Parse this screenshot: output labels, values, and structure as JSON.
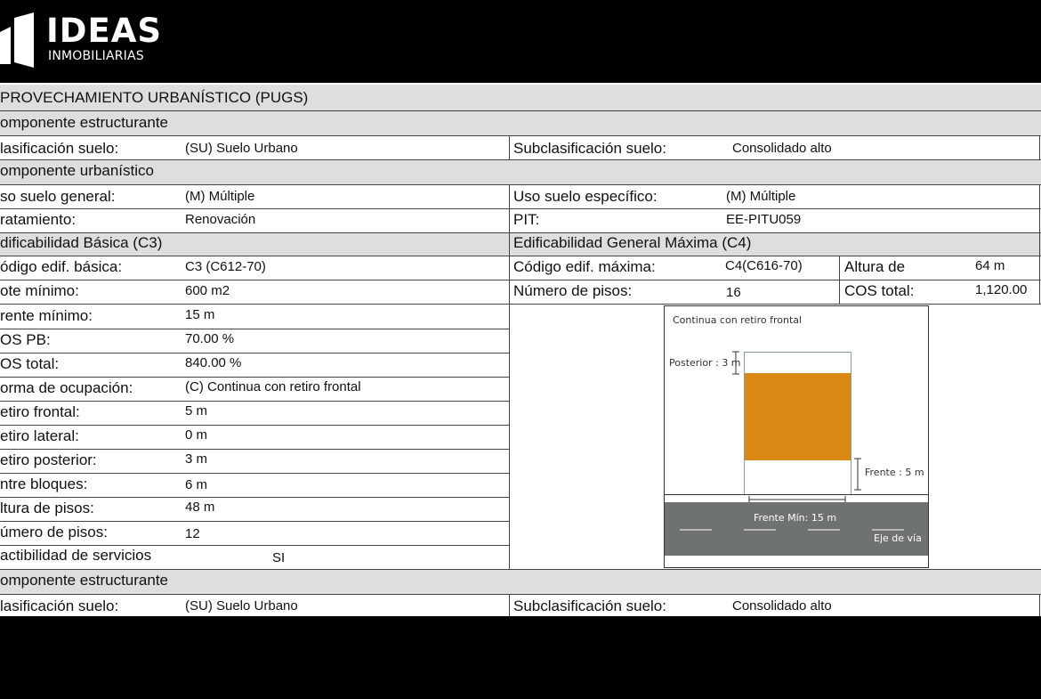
{
  "logo": {
    "title": "IDEAS",
    "subtitle": "INMOBILIARIAS"
  },
  "section_title": "PROVECHAMIENTO URBANÍSTICO (PUGS)",
  "comp1": {
    "header": "omponente  estructurante",
    "clas_label": "lasificación suelo:",
    "clas_value": "(SU) Suelo Urbano",
    "subclas_label": "Subclasificación suelo:",
    "subclas_value": "Consolidado alto"
  },
  "comp2": {
    "header": "omponente  urbanístico",
    "uso_gen_label": "so suelo general:",
    "uso_gen_value": "(M) Múltiple",
    "uso_esp_label": "Uso suelo específico:",
    "uso_esp_value": "(M) Múltiple",
    "trat_label": "ratamiento:",
    "trat_value": "Renovación",
    "pit_label": "PIT:",
    "pit_value": "EE-PITU059"
  },
  "basica": {
    "header": "dificabilidad Básica (C3)",
    "rows": [
      {
        "label": "ódigo edif. básica:",
        "value": "C3 (C612-70)"
      },
      {
        "label": "ote mínimo:",
        "value": "600 m2"
      },
      {
        "label": "rente mínimo:",
        "value": "15 m"
      },
      {
        "label": "OS PB:",
        "value": "70.00 %"
      },
      {
        "label": "OS total:",
        "value": "840.00 %"
      },
      {
        "label": "orma de ocupación:",
        "value": "(C) Continua con retiro frontal"
      },
      {
        "label": "etiro frontal:",
        "value": "5 m"
      },
      {
        "label": "etiro lateral:",
        "value": "0 m"
      },
      {
        "label": "etiro posterior:",
        "value": "3 m"
      },
      {
        "label": "ntre bloques:",
        "value": "6 m"
      },
      {
        "label": "ltura de pisos:",
        "value": "48 m"
      },
      {
        "label": "úmero de pisos:",
        "value": "12"
      },
      {
        "label": "actibilidad de servicios",
        "value": "SI"
      }
    ]
  },
  "maxima": {
    "header": "Edificabilidad General Máxima (C4)",
    "cod_label": "Código edif. máxima:",
    "cod_value": "C4(C616-70)",
    "altura_label": "Altura de",
    "altura_value": "64 m",
    "pisos_label": "Número de pisos:",
    "pisos_value": "16",
    "cos_label": "COS total:",
    "cos_value": "1,120.00"
  },
  "diagram": {
    "caption": "Continua con retiro frontal",
    "posterior": "Posterior : 3 m",
    "frente": "Frente : 5 m",
    "frente_min": "Frente Mín: 15 m",
    "eje": "Eje de vía",
    "building_color": "#d98914",
    "road_color": "#6e7370"
  },
  "comp3": {
    "header": "omponente  estructurante",
    "clas_label": "lasificación suelo:",
    "clas_value": "(SU) Suelo Urbano",
    "subclas_label": "Subclasificación suelo:",
    "subclas_value": "Consolidado alto"
  }
}
